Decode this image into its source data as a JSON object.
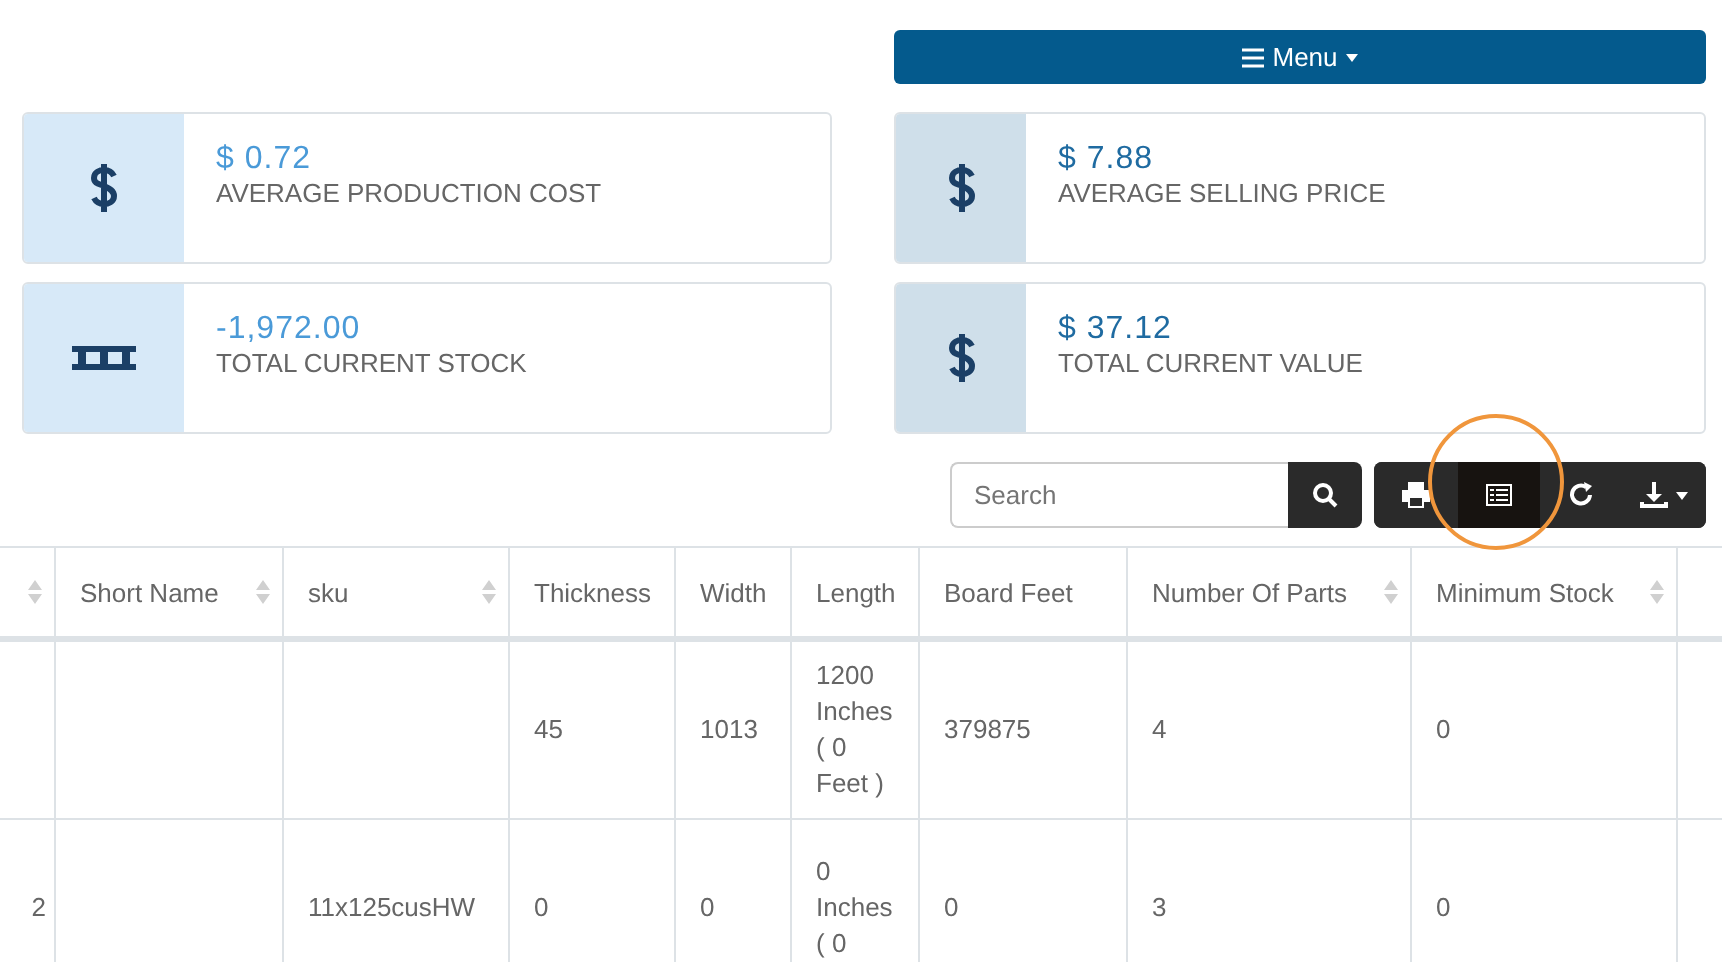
{
  "menu_button": {
    "label": "Menu"
  },
  "stats": [
    {
      "kind": "money",
      "value": "$ 0.72",
      "label": "AVERAGE PRODUCTION COST"
    },
    {
      "kind": "money",
      "value": "$ 7.88",
      "label": "AVERAGE SELLING PRICE"
    },
    {
      "kind": "stock",
      "value": "-1,972.00",
      "label": "TOTAL CURRENT STOCK"
    },
    {
      "kind": "money",
      "value": "$ 37.12",
      "label": "TOTAL CURRENT VALUE"
    }
  ],
  "search": {
    "placeholder": "Search"
  },
  "toolbar": [
    {
      "kind": "print",
      "selected": false
    },
    {
      "kind": "columns",
      "selected": true
    },
    {
      "kind": "refresh",
      "selected": false
    },
    {
      "kind": "export",
      "selected": false
    }
  ],
  "table": {
    "columns": [
      {
        "sortable": true
      },
      {
        "label": "Short Name",
        "sortable": true
      },
      {
        "label": "sku",
        "sortable": true
      },
      {
        "label": "Thickness",
        "sortable": false
      },
      {
        "label": "Width",
        "sortable": false
      },
      {
        "label": "Length",
        "sortable": false
      },
      {
        "label": "Board Feet",
        "sortable": false
      },
      {
        "label": "Number Of Parts",
        "sortable": true
      },
      {
        "label": "Minimum Stock",
        "sortable": true
      }
    ],
    "rows": [
      [
        "",
        "",
        "",
        "45",
        "1013",
        "1200 Inches ( 0 Feet )",
        "379875",
        "4",
        "0"
      ],
      [
        "2",
        "",
        "11x125cusHW",
        "0",
        "0",
        "0 Inches ( 0",
        "0",
        "3",
        "0"
      ]
    ]
  }
}
